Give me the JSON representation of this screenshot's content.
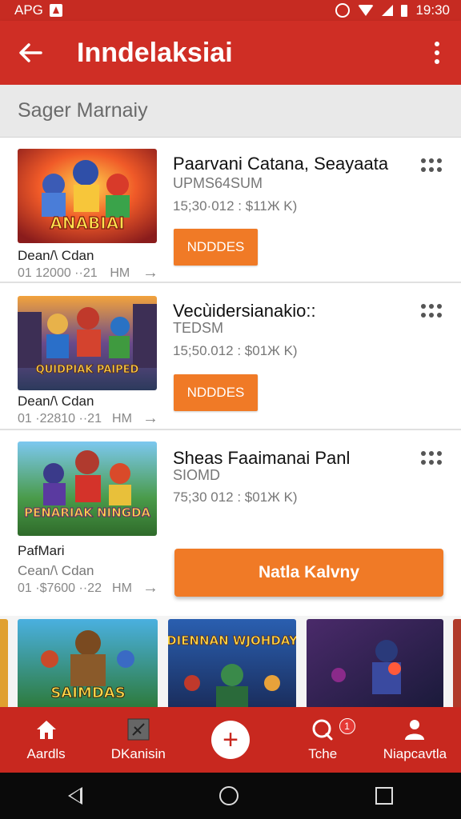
{
  "status_bar": {
    "carrier": "APG",
    "time": "19:30"
  },
  "app_bar": {
    "title": "Inndelaksiai"
  },
  "section": {
    "title": "Sager Marnaiy"
  },
  "cards": [
    {
      "thumb_text": "ANABIAI",
      "meta_name": "Dean/\\ Cdan",
      "meta_code": "01 12000 ··21",
      "meta_unit": "HM",
      "title": "Paarvani Catana, Seayaata",
      "subtitle": "UPMS64SUM",
      "price": "15;30·012 :  $11Ж K)",
      "button": "NDDDES"
    },
    {
      "thumb_text": "QUIDPIAK PAIPED",
      "meta_name": "Dean/\\ Cdan",
      "meta_code": "01 ·22810 ··21",
      "meta_unit": "HM",
      "title": "Vecùidersianakio::",
      "subtitle": "TEDSM",
      "price": "15;50.012 :  $01Ж K)",
      "button": "NDDDES"
    },
    {
      "thumb_text": "PENARIAK NINGDA",
      "meta_label": "PafMari",
      "meta_name": "Cean/\\ Cdan",
      "meta_code": "01 ·$7600 ··22",
      "meta_unit": "HM",
      "title": "Sheas Faaimanai Panl",
      "subtitle": "SIOMD",
      "price": "75;30 012 :  $01Ж K)",
      "button": "Natla Kalvny"
    }
  ],
  "carousel": [
    {
      "text": "SAIMDAS"
    },
    {
      "text": "DIENNAN WJOHDAY"
    },
    {
      "text": ""
    }
  ],
  "bottom_nav": {
    "items": [
      {
        "label": "Aardls",
        "icon": "home-icon"
      },
      {
        "label": "DKanisin",
        "icon": "gallery-icon"
      },
      {
        "label": "",
        "icon": "plus-icon"
      },
      {
        "label": "Tche",
        "icon": "chat-icon",
        "badge": "1"
      },
      {
        "label": "Niapcavtla",
        "icon": "person-icon"
      }
    ]
  },
  "colors": {
    "primary": "#cf2e25",
    "accent": "#f07a26",
    "badge": "#e53935"
  }
}
